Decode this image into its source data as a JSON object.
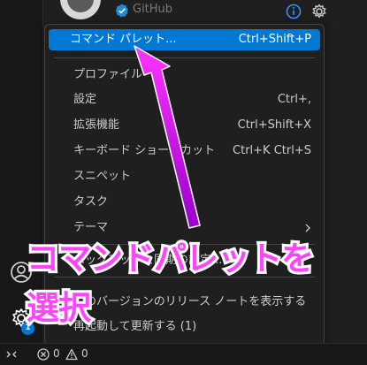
{
  "header": {
    "account_name": "GitHub"
  },
  "menu": {
    "highlighted": {
      "label": "コマンド パレット...",
      "shortcut": "Ctrl+Shift+P"
    },
    "items": [
      {
        "label": "プロファイル",
        "shortcut": ""
      },
      {
        "label": "設定",
        "shortcut": "Ctrl+,"
      },
      {
        "label": "拡張機能",
        "shortcut": "Ctrl+Shift+X"
      },
      {
        "label": "キーボード ショートカット",
        "shortcut": "Ctrl+K Ctrl+S"
      },
      {
        "label": "スニペット",
        "shortcut": ""
      },
      {
        "label": "タスク",
        "shortcut": ""
      },
      {
        "label": "テーマ",
        "shortcut": ""
      },
      {
        "label": "バックアップと同期の設定...",
        "shortcut": ""
      },
      {
        "label": "このバージョンのリリース ノートを表示する",
        "shortcut": ""
      },
      {
        "label": "再起動して更新する (1)",
        "shortcut": ""
      }
    ]
  },
  "activity_bar": {
    "manage_badge": "1"
  },
  "status_bar": {
    "errors": "0",
    "warnings": "0"
  },
  "annotation": {
    "line1": "コマンドパレットを",
    "line2": "選択"
  },
  "colors": {
    "accent": "#0078d4",
    "annotation": "#ff44ff"
  }
}
